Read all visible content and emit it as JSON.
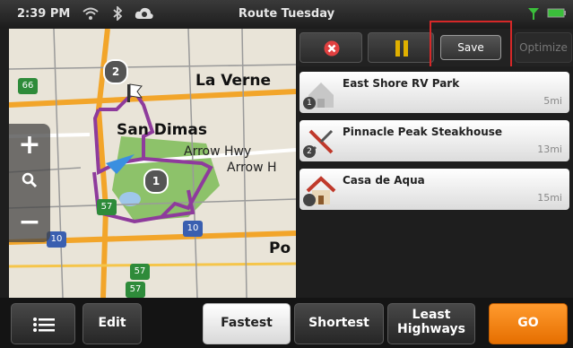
{
  "status": {
    "time": "2:39 PM",
    "title": "Route Tuesday"
  },
  "toolbar": {
    "save_label": "Save",
    "optimize_label": "Optimize"
  },
  "map": {
    "labels": {
      "la_verne": "La Verne",
      "san_dimas": "San Dimas",
      "arrow_hwy": "Arrow Hwy",
      "arrow_hwy_2": "Arrow H",
      "po": "Po"
    },
    "shields": {
      "s66": "66",
      "s57a": "57",
      "s57b": "57",
      "s57c": "57",
      "s10a": "10",
      "s10b": "10"
    },
    "stops": {
      "stop1": "1",
      "stop2": "2"
    }
  },
  "stops": [
    {
      "name": "East Shore RV Park",
      "distance": "5mi",
      "number": "1"
    },
    {
      "name": "Pinnacle Peak Steakhouse",
      "distance": "13mi",
      "number": "2"
    },
    {
      "name": "Casa de Aqua",
      "distance": "15mi",
      "number": ""
    }
  ],
  "bottom": {
    "edit_label": "Edit",
    "fastest_label": "Fastest",
    "shortest_label": "Shortest",
    "least_label_1": "Least",
    "least_label_2": "Highways",
    "go_label": "GO"
  },
  "colors": {
    "accent": "#f07d00",
    "route": "#8e3b9c",
    "highlight": "#d62828"
  }
}
